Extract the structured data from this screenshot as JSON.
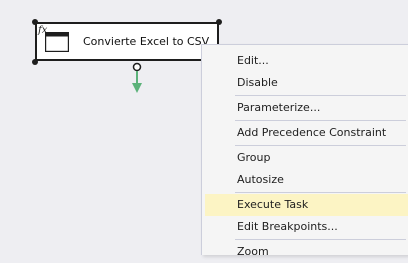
{
  "task": {
    "title": "Convierte Excel to CSV",
    "badge_icon": "fx-expression-icon",
    "icon": "window-task-icon"
  },
  "colors": {
    "canvas": "#eeeef2",
    "connector": "#5cb27a",
    "menu_bg": "#f5f5f5",
    "menu_hover": "#fcf4c4",
    "separator": "#cccedb"
  },
  "context_menu": {
    "items": [
      {
        "label": "Edit..."
      },
      {
        "label": "Disable"
      },
      {
        "label": "Parameterize..."
      },
      {
        "label": "Add Precedence Constraint"
      },
      {
        "label": "Group"
      },
      {
        "label": "Autosize"
      },
      {
        "label": "Execute Task",
        "highlighted": true
      },
      {
        "label": "Edit Breakpoints..."
      },
      {
        "label": "Zoom"
      }
    ]
  }
}
